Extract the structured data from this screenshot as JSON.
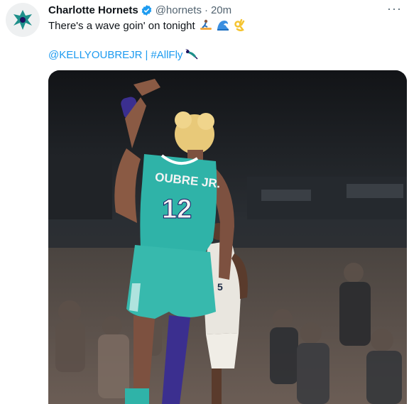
{
  "tweet": {
    "display_name": "Charlotte Hornets",
    "handle": "@hornets",
    "separator": "·",
    "time": "20m",
    "text": "There's a wave goin' on tonight",
    "emojis": [
      "surfer-icon",
      "wave-icon",
      "ok-hand-icon"
    ],
    "mention": "@KELLYOUBREJR",
    "link_separator": "|",
    "hashtag": "#AllFly",
    "hashtag_emoji": "hornet-icon",
    "more_label": "···"
  },
  "media": {
    "jersey_name": "OUBRE JR.",
    "jersey_number": "12",
    "opponent_number": "5",
    "colors": {
      "jersey_teal": "#2fb3a8",
      "shorts_teal": "#37b9ad",
      "dark_background": "#1b1e22",
      "hair": "#e8c979",
      "skin": "#8a5a44"
    }
  }
}
